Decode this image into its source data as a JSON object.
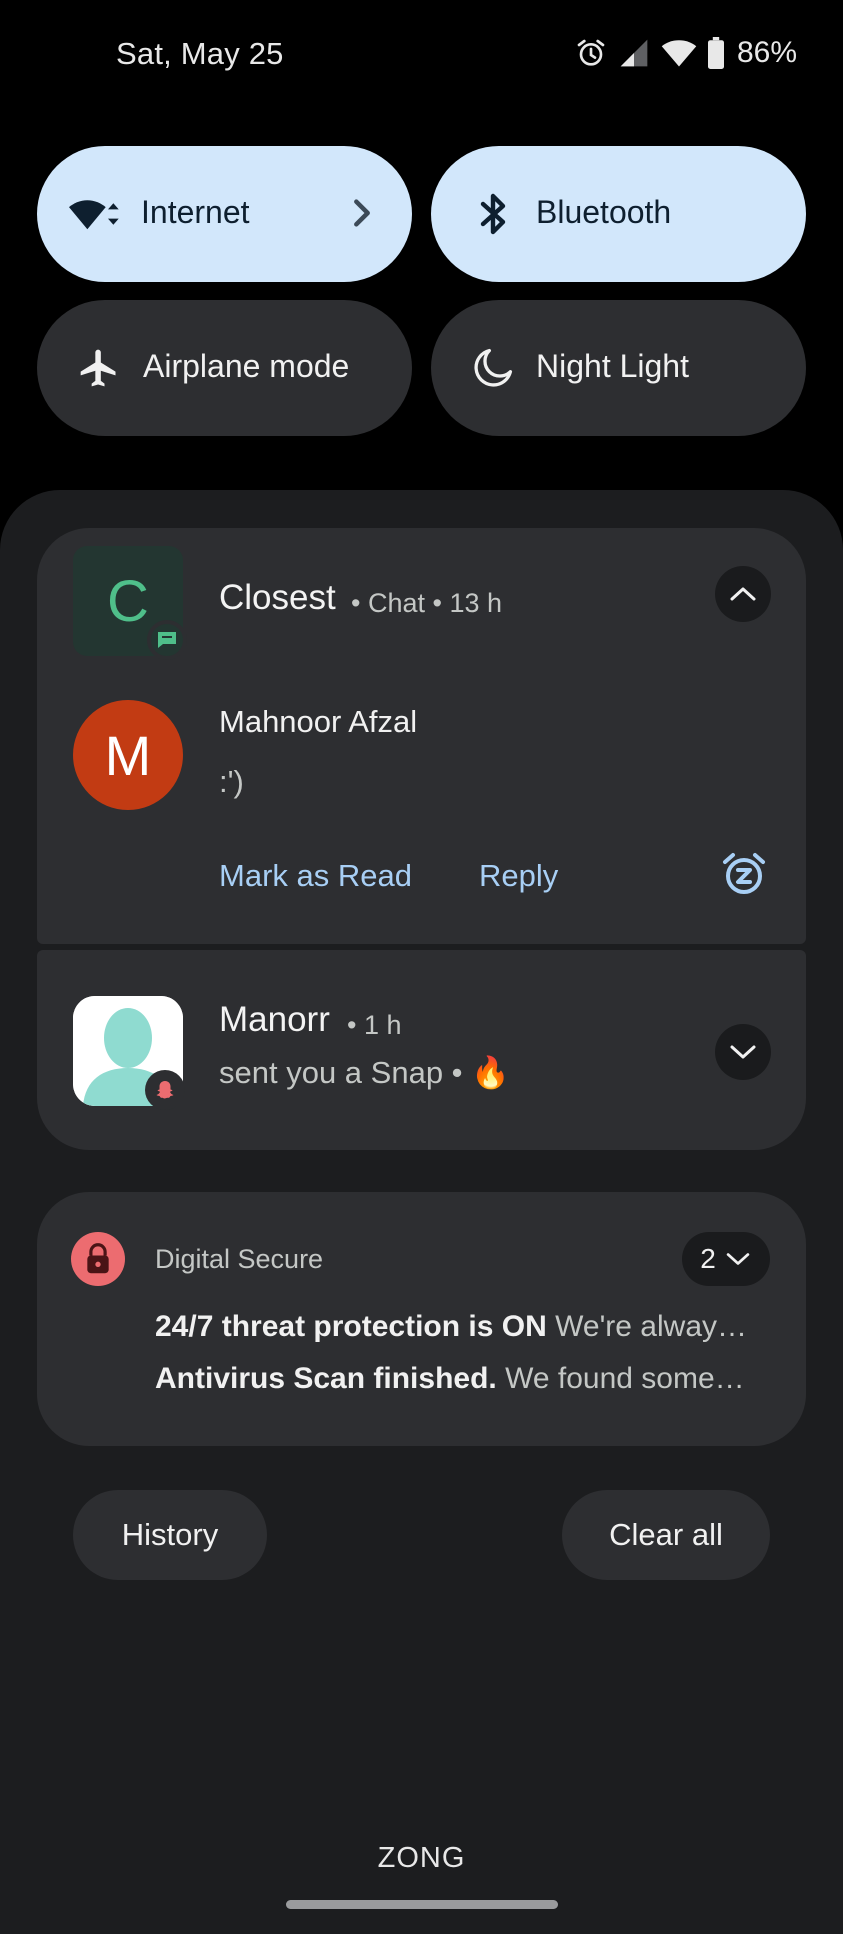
{
  "status_bar": {
    "date": "Sat, May 25",
    "battery_percent": "86%",
    "icons": [
      "alarm-icon",
      "cell-signal-icon",
      "wifi-icon",
      "battery-icon"
    ]
  },
  "quick_tiles": [
    {
      "label": "Internet",
      "icon": "wifi-icon",
      "active": true,
      "has_chevron": true
    },
    {
      "label": "Bluetooth",
      "icon": "bluetooth-icon",
      "active": true
    },
    {
      "label": "Airplane mode",
      "icon": "airplane-icon",
      "active": false
    },
    {
      "label": "Night Light",
      "icon": "moon-icon",
      "active": false
    }
  ],
  "notifications": {
    "closest": {
      "avatar_letter": "C",
      "title": "Closest",
      "meta": "• Chat • 13 h",
      "message": {
        "avatar_letter": "M",
        "sender": "Mahnoor Afzal",
        "text": ":')"
      },
      "actions": {
        "mark_read": "Mark as Read",
        "reply": "Reply"
      }
    },
    "manorr": {
      "title": "Manorr",
      "meta": "• 1 h",
      "text": "sent you a Snap •",
      "emoji": "🔥"
    },
    "digital_secure": {
      "app": "Digital Secure",
      "count": "2",
      "lines": [
        {
          "bold": "24/7 threat protection is ON",
          "rest": "We're alway…"
        },
        {
          "bold": "Antivirus Scan finished.",
          "rest": "We found some…"
        }
      ]
    }
  },
  "buttons": {
    "history": "History",
    "clear_all": "Clear all"
  },
  "carrier": "ZONG",
  "colors": {
    "tile_active": "#d2e7fb",
    "tile_inactive": "#2d2e31",
    "accent_link": "#a8cff5",
    "avatar_m": "#c23b13",
    "chat_green": "#4fbf8a",
    "security_red": "#ec6c70"
  }
}
